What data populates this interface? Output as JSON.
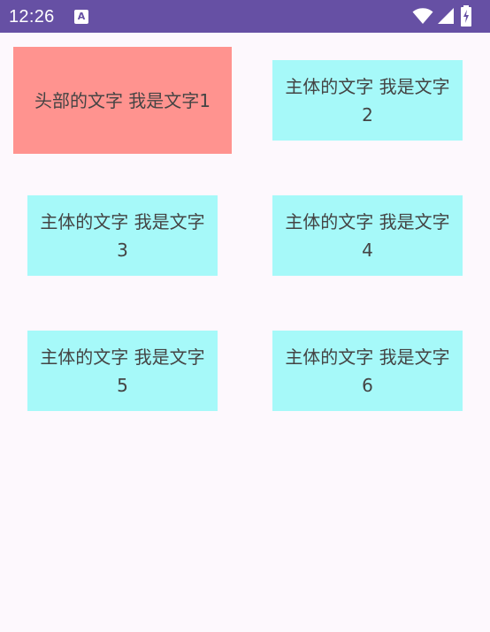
{
  "status_bar": {
    "time": "12:26",
    "notification_icon_letter": "A",
    "background_color": "#6650a4"
  },
  "colors": {
    "header_card": "#ff938f",
    "body_card": "#a6f9f9",
    "text": "#444444",
    "page_background": "#fdf8fd"
  },
  "grid": {
    "header_text": "头部的文字 我是文字1",
    "body_texts": [
      "主体的文字 我是文字2",
      "主体的文字 我是文字3",
      "主体的文字 我是文字4",
      "主体的文字 我是文字5",
      "主体的文字 我是文字6"
    ]
  }
}
